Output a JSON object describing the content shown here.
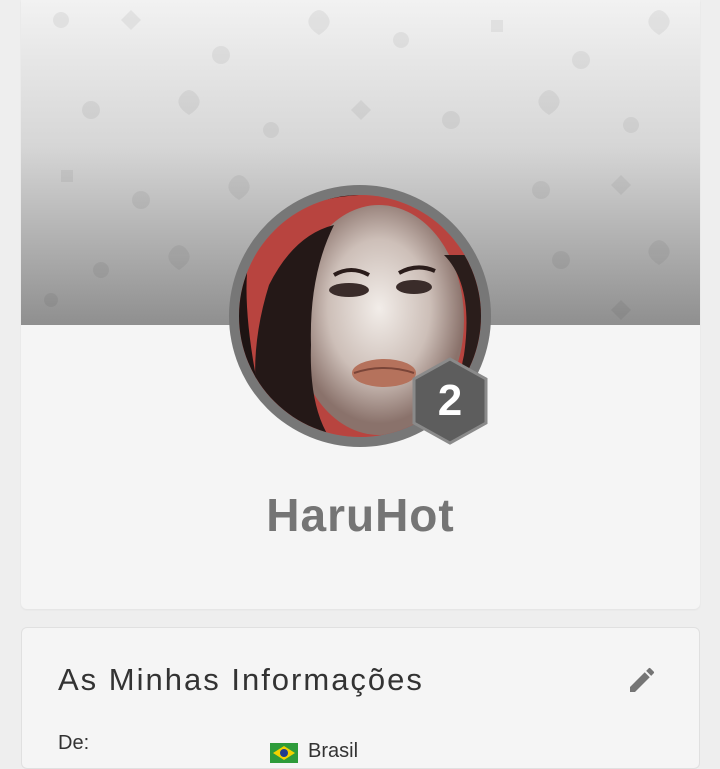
{
  "profile": {
    "username": "HaruHot",
    "level": "2",
    "avatar_icon": "user-photo"
  },
  "info": {
    "title": "As Minhas Informações",
    "from_label": "De:",
    "country": "Brasil",
    "edit_icon": "pencil-icon"
  }
}
